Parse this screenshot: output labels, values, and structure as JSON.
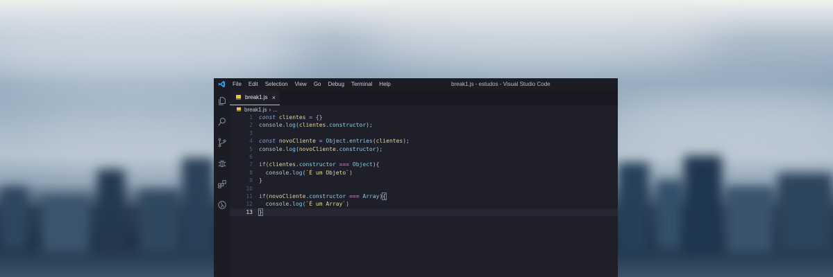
{
  "window": {
    "title": "break1.js - estudos - Visual Studio Code",
    "menu": [
      "File",
      "Edit",
      "Selection",
      "View",
      "Go",
      "Debug",
      "Terminal",
      "Help"
    ]
  },
  "activity_bar": [
    "files-icon",
    "search-icon",
    "source-control-icon",
    "debug-icon",
    "extensions-icon",
    "remote-icon"
  ],
  "tab": {
    "label": "break1.js",
    "close": "×"
  },
  "breadcrumb": {
    "file": "break1.js",
    "separator": "›",
    "more": "..."
  },
  "editor": {
    "current_line": 13,
    "lines": [
      {
        "n": "1",
        "tokens": [
          [
            "kw",
            "const"
          ],
          [
            "pun",
            " "
          ],
          [
            "var",
            "clientes"
          ],
          [
            "pun",
            " "
          ],
          [
            "op",
            "="
          ],
          [
            "pun",
            " {}"
          ]
        ]
      },
      {
        "n": "2",
        "tokens": [
          [
            "pun",
            "console."
          ],
          [
            "fn",
            "log"
          ],
          [
            "pun",
            "("
          ],
          [
            "var",
            "clientes"
          ],
          [
            "pun",
            "."
          ],
          [
            "prop",
            "constructor"
          ],
          [
            "pun",
            ");"
          ]
        ]
      },
      {
        "n": "3",
        "tokens": []
      },
      {
        "n": "4",
        "tokens": [
          [
            "kw",
            "const"
          ],
          [
            "pun",
            " "
          ],
          [
            "var",
            "novoCliente"
          ],
          [
            "pun",
            " "
          ],
          [
            "op",
            "="
          ],
          [
            "pun",
            " "
          ],
          [
            "obj",
            "Object"
          ],
          [
            "pun",
            "."
          ],
          [
            "fn",
            "entries"
          ],
          [
            "pun",
            "("
          ],
          [
            "var",
            "clientes"
          ],
          [
            "pun",
            ");"
          ]
        ]
      },
      {
        "n": "5",
        "tokens": [
          [
            "pun",
            "console."
          ],
          [
            "fn",
            "log"
          ],
          [
            "pun",
            "("
          ],
          [
            "var",
            "novoCliente"
          ],
          [
            "pun",
            "."
          ],
          [
            "prop",
            "constructor"
          ],
          [
            "pun",
            ");"
          ]
        ]
      },
      {
        "n": "6",
        "tokens": []
      },
      {
        "n": "7",
        "tokens": [
          [
            "ctl",
            "if"
          ],
          [
            "pun",
            "("
          ],
          [
            "var",
            "clientes"
          ],
          [
            "pun",
            "."
          ],
          [
            "prop",
            "constructor"
          ],
          [
            "pun",
            " "
          ],
          [
            "op",
            "==="
          ],
          [
            "pun",
            " "
          ],
          [
            "obj",
            "Object"
          ],
          [
            "pun",
            "){"
          ]
        ]
      },
      {
        "n": "8",
        "tokens": [
          [
            "pun",
            "  console."
          ],
          [
            "fn",
            "log"
          ],
          [
            "pun",
            "("
          ],
          [
            "str",
            "`É um Objeto`"
          ],
          [
            "pun",
            ")"
          ]
        ]
      },
      {
        "n": "9",
        "tokens": [
          [
            "pun",
            "}"
          ]
        ]
      },
      {
        "n": "10",
        "tokens": []
      },
      {
        "n": "11",
        "tokens": [
          [
            "ctl",
            "if"
          ],
          [
            "pun",
            "("
          ],
          [
            "var",
            "novoCliente"
          ],
          [
            "pun",
            "."
          ],
          [
            "prop",
            "constructor"
          ],
          [
            "pun",
            " "
          ],
          [
            "op",
            "==="
          ],
          [
            "pun",
            " "
          ],
          [
            "obj",
            "Array"
          ],
          [
            "pun",
            ")"
          ],
          [
            "bm",
            "{"
          ]
        ]
      },
      {
        "n": "12",
        "tokens": [
          [
            "pun",
            "  console."
          ],
          [
            "fn",
            "log"
          ],
          [
            "pun",
            "("
          ],
          [
            "str",
            "`É um Array`"
          ],
          [
            "pun",
            ")"
          ]
        ]
      },
      {
        "n": "13",
        "tokens": [
          [
            "bm",
            "}"
          ]
        ]
      }
    ]
  },
  "colors": {
    "editor_bg": "#1e1f29",
    "tab_accent": "#d8c36a",
    "js_badge": "#e8c547"
  }
}
